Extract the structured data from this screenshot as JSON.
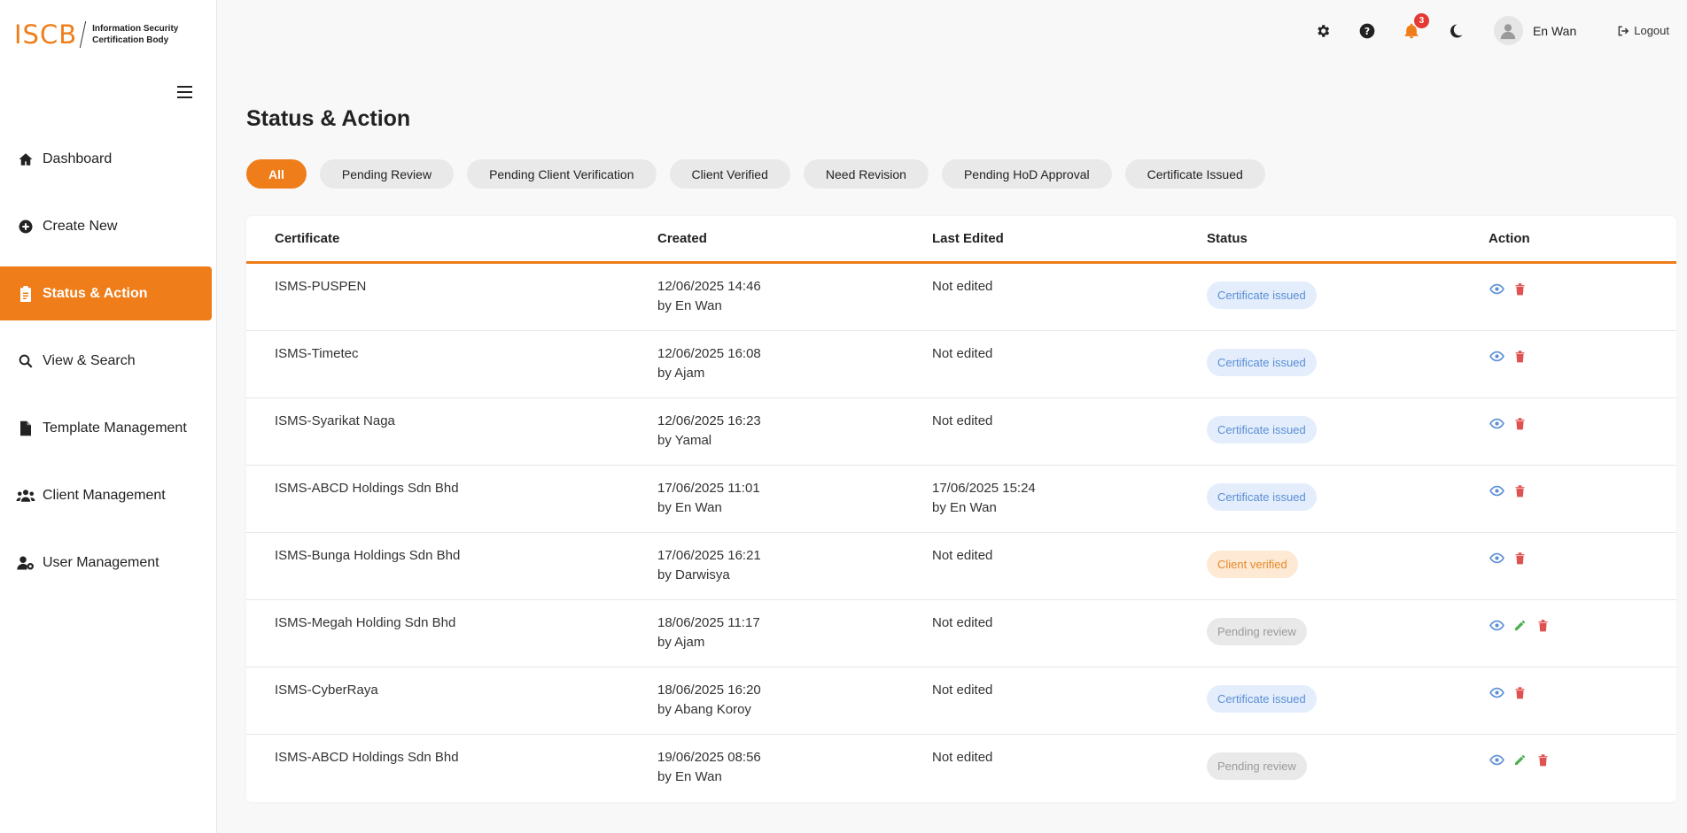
{
  "brand": {
    "logo_text": "ISCB",
    "logo_sub_line1": "Information Security",
    "logo_sub_line2": "Certification Body",
    "accent_color": "#ef7d1a"
  },
  "sidebar": {
    "items": [
      {
        "label": "Dashboard",
        "icon": "home-icon"
      },
      {
        "label": "Create New",
        "icon": "plus-circle-icon"
      },
      {
        "label": "Status & Action",
        "icon": "clipboard-icon",
        "active": true
      },
      {
        "label": "View & Search",
        "icon": "search-icon"
      },
      {
        "label": "Template Management",
        "icon": "file-icon"
      },
      {
        "label": "Client Management",
        "icon": "users-icon"
      },
      {
        "label": "User Management",
        "icon": "user-gear-icon"
      }
    ]
  },
  "topbar": {
    "notification_count": "3",
    "user_name": "En Wan",
    "logout_label": "Logout"
  },
  "page": {
    "title": "Status & Action"
  },
  "filters": [
    {
      "label": "All",
      "active": true
    },
    {
      "label": "Pending Review"
    },
    {
      "label": "Pending Client Verification"
    },
    {
      "label": "Client Verified"
    },
    {
      "label": "Need Revision"
    },
    {
      "label": "Pending HoD Approval"
    },
    {
      "label": "Certificate Issued"
    }
  ],
  "table": {
    "headers": {
      "certificate": "Certificate",
      "created": "Created",
      "last_edited": "Last Edited",
      "status": "Status",
      "action": "Action"
    },
    "rows": [
      {
        "certificate": "ISMS-PUSPEN",
        "created_date": "12/06/2025 14:46",
        "created_by": "by En Wan",
        "edited_date": "Not edited",
        "edited_by": "",
        "status": "Certificate issued",
        "status_type": "issued",
        "editable": false
      },
      {
        "certificate": "ISMS-Timetec",
        "created_date": "12/06/2025 16:08",
        "created_by": "by Ajam",
        "edited_date": "Not edited",
        "edited_by": "",
        "status": "Certificate issued",
        "status_type": "issued",
        "editable": false
      },
      {
        "certificate": "ISMS-Syarikat Naga",
        "created_date": "12/06/2025 16:23",
        "created_by": "by Yamal",
        "edited_date": "Not edited",
        "edited_by": "",
        "status": "Certificate issued",
        "status_type": "issued",
        "editable": false
      },
      {
        "certificate": "ISMS-ABCD Holdings Sdn Bhd",
        "created_date": "17/06/2025 11:01",
        "created_by": "by En Wan",
        "edited_date": "17/06/2025 15:24",
        "edited_by": "by En Wan",
        "status": "Certificate issued",
        "status_type": "issued",
        "editable": false
      },
      {
        "certificate": "ISMS-Bunga Holdings Sdn Bhd",
        "created_date": "17/06/2025 16:21",
        "created_by": "by Darwisya",
        "edited_date": "Not edited",
        "edited_by": "",
        "status": "Client verified",
        "status_type": "verified",
        "editable": false
      },
      {
        "certificate": "ISMS-Megah Holding Sdn Bhd",
        "created_date": "18/06/2025 11:17",
        "created_by": "by Ajam",
        "edited_date": "Not edited",
        "edited_by": "",
        "status": "Pending review",
        "status_type": "pending",
        "editable": true
      },
      {
        "certificate": "ISMS-CyberRaya",
        "created_date": "18/06/2025 16:20",
        "created_by": "by Abang Koroy",
        "edited_date": "Not edited",
        "edited_by": "",
        "status": "Certificate issued",
        "status_type": "issued",
        "editable": false
      },
      {
        "certificate": "ISMS-ABCD Holdings Sdn Bhd",
        "created_date": "19/06/2025 08:56",
        "created_by": "by En Wan",
        "edited_date": "Not edited",
        "edited_by": "",
        "status": "Pending review",
        "status_type": "pending",
        "editable": true
      }
    ]
  },
  "status_colors": {
    "issued": {
      "bg": "#e3edfb",
      "fg": "#5b8fd6"
    },
    "verified": {
      "bg": "#fde9d4",
      "fg": "#e48a2c"
    },
    "pending": {
      "bg": "#e9e9e9",
      "fg": "#9a9a9a"
    }
  }
}
